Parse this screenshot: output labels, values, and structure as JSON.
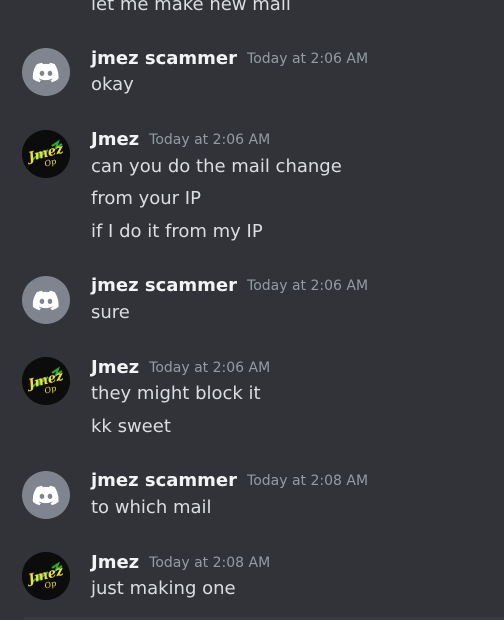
{
  "top_partial": "let me make new mail",
  "messages": [
    {
      "author": "jmez scammer",
      "time": "Today at 2:06 AM",
      "lines": [
        "okay"
      ]
    },
    {
      "author": "Jmez",
      "time": "Today at 2:06 AM",
      "lines": [
        "can you do the mail change",
        "from your IP",
        "if I do it from my IP"
      ]
    },
    {
      "author": "jmez scammer",
      "time": "Today at 2:06 AM",
      "lines": [
        "sure"
      ]
    },
    {
      "author": "Jmez",
      "time": "Today at 2:06 AM",
      "lines": [
        "they might block it",
        "kk sweet"
      ]
    },
    {
      "author": "jmez scammer",
      "time": "Today at 2:08 AM",
      "lines": [
        "to which mail"
      ]
    },
    {
      "author": "Jmez",
      "time": "Today at 2:08 AM",
      "lines": [
        "just making one"
      ]
    }
  ],
  "avatars": {
    "scammer_icon": "discord-logo-icon",
    "jmez_icon": "jmez-logo",
    "jmez_logo_text": "Jmez",
    "jmez_logo_sub": "Op"
  },
  "colors": {
    "background": "#313338",
    "text": "#dbdee1",
    "timestamp": "#949ba4",
    "discord_avatar": "#80848e"
  }
}
